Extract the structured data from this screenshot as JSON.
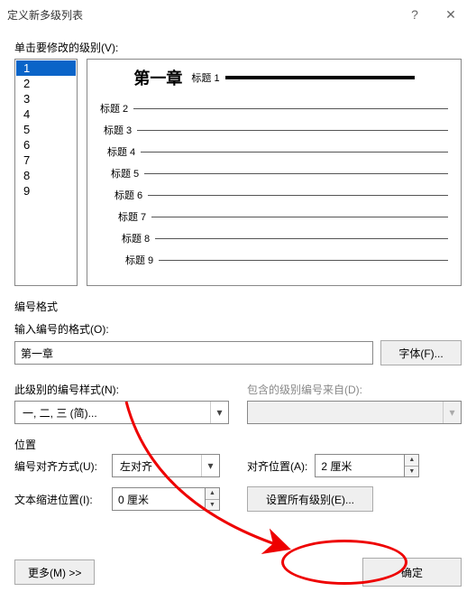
{
  "titlebar": {
    "title": "定义新多级列表"
  },
  "levels": {
    "label": "单击要修改的级别(V):",
    "items": [
      "1",
      "2",
      "3",
      "4",
      "5",
      "6",
      "7",
      "8",
      "9"
    ],
    "selected": 0
  },
  "preview": {
    "first_prefix": "第一章",
    "first_sub": "标题 1",
    "rows": [
      "标题 2",
      "标题 3",
      "标题 4",
      "标题 5",
      "标题 6",
      "标题 7",
      "标题 8",
      "标题 9"
    ]
  },
  "number_format": {
    "section": "编号格式",
    "enter_label": "输入编号的格式(O):",
    "value": "第一章",
    "font_btn": "字体(F)...",
    "style_label": "此级别的编号样式(N):",
    "style_value": "一, 二, 三 (简)...",
    "include_label": "包含的级别编号来自(D):",
    "include_value": ""
  },
  "position": {
    "section": "位置",
    "align_label": "编号对齐方式(U):",
    "align_value": "左对齐",
    "align_pos_label": "对齐位置(A):",
    "align_pos_value": "2 厘米",
    "indent_label": "文本缩进位置(I):",
    "indent_value": "0 厘米",
    "set_all_btn": "设置所有级别(E)..."
  },
  "footer": {
    "more": "更多(M) >>",
    "ok": "确定"
  }
}
